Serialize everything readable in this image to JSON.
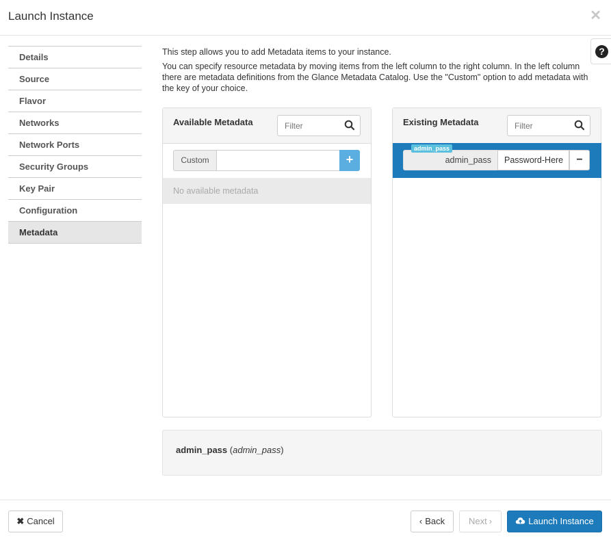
{
  "modal": {
    "title": "Launch Instance",
    "close_icon": "close-icon",
    "help_icon": "question-circle-icon",
    "help_label": "?"
  },
  "nav": {
    "items": [
      {
        "label": "Details"
      },
      {
        "label": "Source"
      },
      {
        "label": "Flavor"
      },
      {
        "label": "Networks"
      },
      {
        "label": "Network Ports"
      },
      {
        "label": "Security Groups"
      },
      {
        "label": "Key Pair"
      },
      {
        "label": "Configuration"
      },
      {
        "label": "Metadata",
        "active": true
      }
    ]
  },
  "intro": {
    "line1": "This step allows you to add Metadata items to your instance.",
    "line2": "You can specify resource metadata by moving items from the left column to the right column. In the left column there are metadata definitions from the Glance Metadata Catalog. Use the \"Custom\" option to add metadata with the key of your choice."
  },
  "available": {
    "title": "Available Metadata",
    "filter_placeholder": "Filter",
    "custom_label": "Custom",
    "add_label": "+",
    "empty_text": "No available metadata"
  },
  "existing": {
    "title": "Existing Metadata",
    "filter_placeholder": "Filter",
    "item": {
      "tag": "admin_pass",
      "key": "admin_pass",
      "value": "Password-Here",
      "remove_label": "−"
    }
  },
  "detail": {
    "name": "admin_pass",
    "key": "admin_pass",
    "open_paren": " (",
    "close_paren": ")"
  },
  "footer": {
    "cancel_label": "Cancel",
    "back_label": "Back",
    "next_label": "Next",
    "launch_label": "Launch Instance"
  },
  "colors": {
    "primary": "#1d7bbb",
    "add_button": "#5bafe0",
    "tag": "#5bc0de"
  }
}
